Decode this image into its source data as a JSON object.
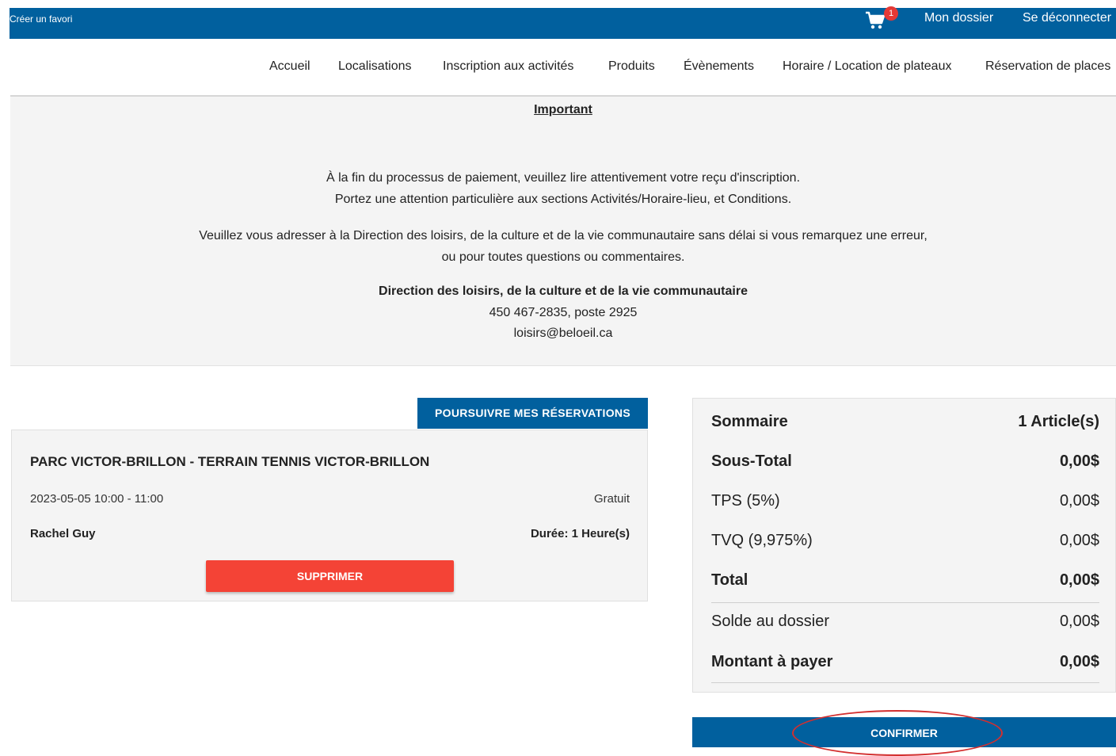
{
  "topbar": {
    "favorite_label": "Créer un favori",
    "cart_count": "1",
    "dossier_label": "Mon dossier",
    "logout_label": "Se déconnecter",
    "bar_color": "#01609e"
  },
  "nav": {
    "items": [
      "Accueil",
      "Localisations",
      "Inscription aux activités",
      "Produits",
      "Évènements",
      "Horaire / Location de plateaux",
      "Réservation de places"
    ]
  },
  "important": {
    "title": "Important",
    "line1": "À la fin du processus de paiement, veuillez lire attentivement votre reçu d'inscription.",
    "line2": "Portez une attention particulière aux sections Activités/Horaire-lieu, et Conditions.",
    "line3": "Veuillez vous adresser à la Direction des loisirs, de la culture et de la vie communautaire sans délai si vous remarquez une erreur,",
    "line4": "ou pour toutes questions ou commentaires.",
    "contact_name": "Direction des loisirs, de la culture et de la vie communautaire",
    "contact_phone": "450 467-2835, poste 2925",
    "contact_email": "loisirs@beloeil.ca"
  },
  "reservation": {
    "continue_label": "POURSUIVRE MES RÉSERVATIONS",
    "name": "PARC VICTOR-BRILLON - TERRAIN TENNIS VICTOR-BRILLON",
    "datetime": "2023-05-05 10:00 - 11:00",
    "price": "Gratuit",
    "person": "Rachel Guy",
    "duration": "Durée: 1 Heure(s)",
    "delete_label": "SUPPRIMER"
  },
  "summary": {
    "title": "Sommaire",
    "count": "1 Article(s)",
    "rows": [
      {
        "label": "Sous-Total",
        "value": "0,00$"
      },
      {
        "label": "TPS (5%)",
        "value": "0,00$"
      },
      {
        "label": "TVQ (9,975%)",
        "value": "0,00$"
      },
      {
        "label": "Total",
        "value": "0,00$"
      },
      {
        "label": "Solde au dossier",
        "value": "0,00$"
      },
      {
        "label": "Montant à payer",
        "value": "0,00$"
      }
    ],
    "confirm_label": "CONFIRMER"
  }
}
